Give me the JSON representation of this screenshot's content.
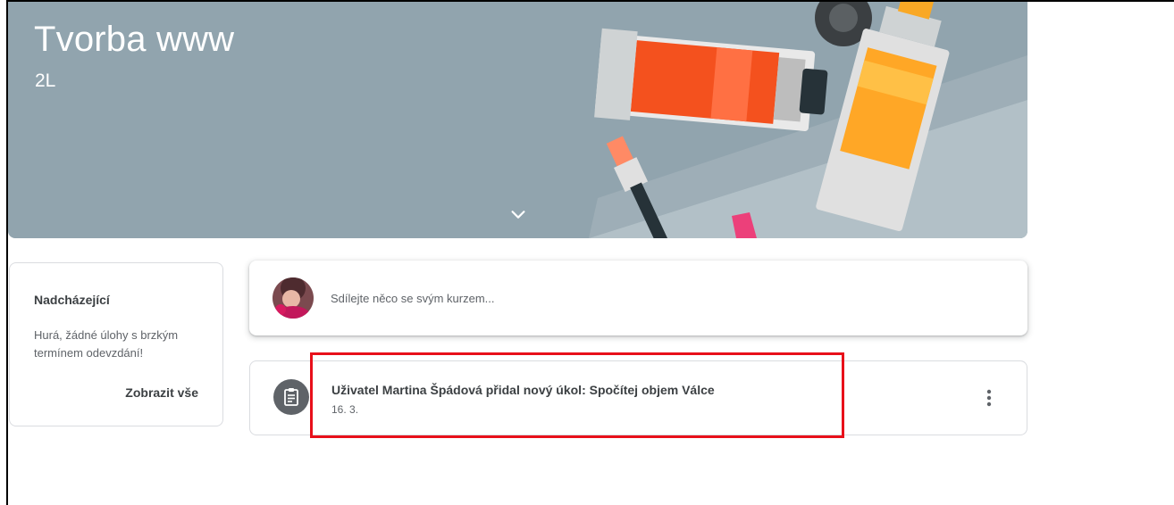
{
  "course": {
    "title": "Tvorba www",
    "section": "2L"
  },
  "upcoming": {
    "title": "Nadcházející",
    "message": "Hurá, žádné úlohy s brzkým termínem odevzdání!",
    "view_all_label": "Zobrazit vše"
  },
  "share": {
    "placeholder": "Sdílejte něco se svým kurzem..."
  },
  "posts": [
    {
      "title": "Uživatel Martina Špádová přidal nový úkol: Spočítej objem Válce",
      "date": "16. 3.",
      "icon": "assignment-icon"
    }
  ],
  "colors": {
    "banner": "#91a4ae",
    "highlight": "#e8101a",
    "icon_circle": "#5f6368"
  }
}
